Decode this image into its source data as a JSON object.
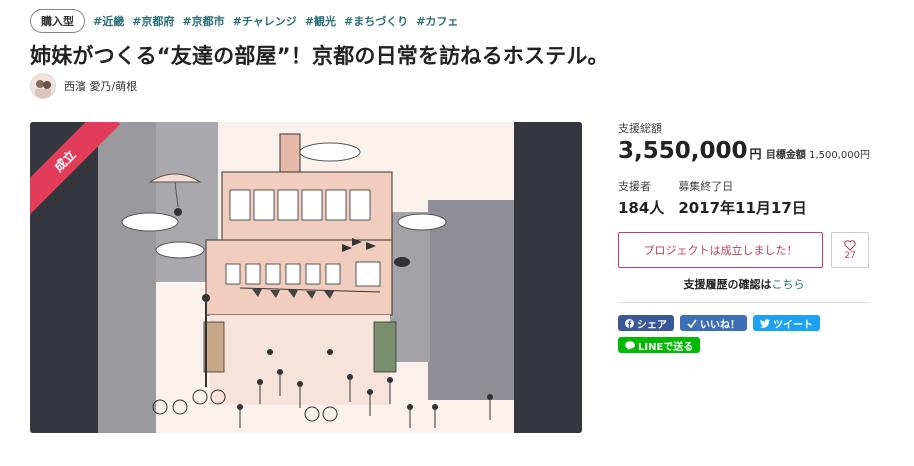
{
  "tags": {
    "type_badge": "購入型",
    "items": [
      "#近畿",
      "#京都府",
      "#京都市",
      "#チャレンジ",
      "#観光",
      "#まちづくり",
      "#カフェ"
    ]
  },
  "title": "姉妹がつくる“友達の部屋”！京都の日常を訪ねるホステル。",
  "owner": {
    "name": "西濱 愛乃/萌根"
  },
  "hero": {
    "ribbon": "成立"
  },
  "sidebar": {
    "total_label": "支援総額",
    "total_value": "3,550,000",
    "yen": "円",
    "goal_label": "目標金額",
    "goal_value": "1,500,000円",
    "backers_label": "支援者",
    "backers_value": "184人",
    "end_label": "募集終了日",
    "end_value": "2017年11月17日",
    "success_button": "プロジェクトは成立しました！",
    "like_count": "27",
    "history_text": "支援履歴の確認は",
    "history_link": "こちら"
  },
  "share": {
    "facebook": "シェア",
    "like": "いいね！",
    "tweet": "ツイート",
    "line": "LINEで送る"
  },
  "colors": {
    "accent": "#e23c5b",
    "tag": "#2a6f7a",
    "facebook": "#3b5998",
    "twitter": "#1da1f2",
    "line": "#00b900"
  }
}
